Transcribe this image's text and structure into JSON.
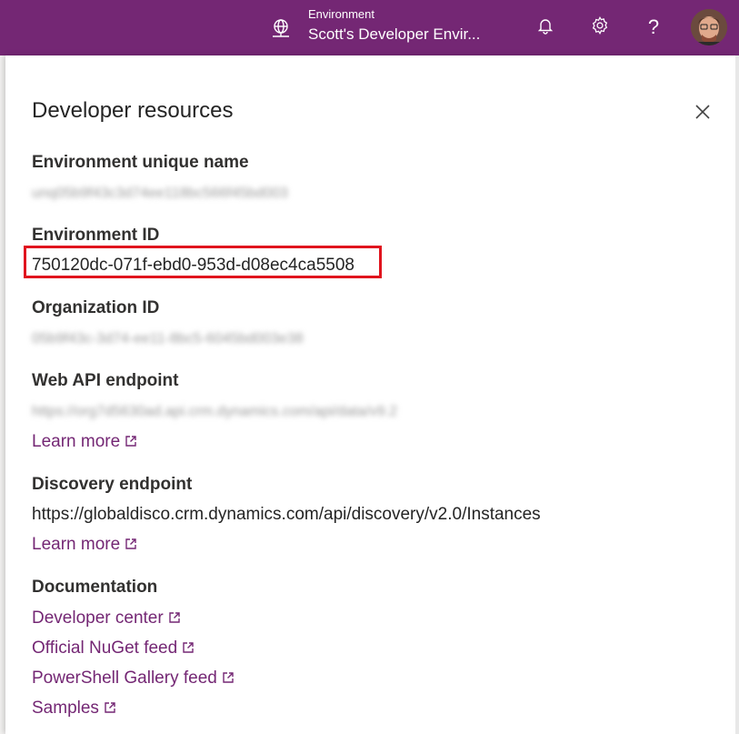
{
  "header": {
    "environment_caption": "Environment",
    "environment_name": "Scott's Developer Envir..."
  },
  "panel": {
    "title": "Developer resources",
    "sections": {
      "env_unique_name": {
        "label": "Environment unique name",
        "value": "unq05b9f43c3d74ee118bc566f45bd003"
      },
      "env_id": {
        "label": "Environment ID",
        "value": "750120dc-071f-ebd0-953d-d08ec4ca5508"
      },
      "org_id": {
        "label": "Organization ID",
        "value": "05b9f43c-3d74-ee11-8bc5-6045bd003e38"
      },
      "web_api": {
        "label": "Web API endpoint",
        "value": "https://org7d5630ad.api.crm.dynamics.com/api/data/v9.2",
        "link": "Learn more"
      },
      "discovery": {
        "label": "Discovery endpoint",
        "value": "https://globaldisco.crm.dynamics.com/api/discovery/v2.0/Instances",
        "link": "Learn more"
      },
      "documentation": {
        "label": "Documentation",
        "links": [
          "Developer center",
          "Official NuGet feed",
          "PowerShell Gallery feed",
          "Samples"
        ]
      }
    }
  },
  "colors": {
    "brand": "#742774",
    "highlight": "#e0141e",
    "link": "#742774"
  },
  "icons": [
    "environment-icon",
    "bell-icon",
    "gear-icon",
    "help-icon",
    "avatar",
    "close-icon",
    "external-link-icon"
  ]
}
